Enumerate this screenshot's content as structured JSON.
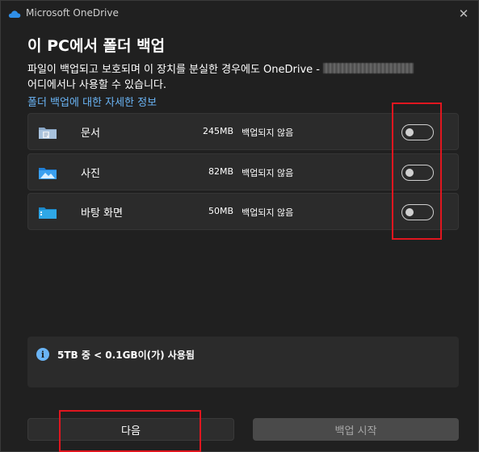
{
  "window": {
    "title": "Microsoft OneDrive",
    "close_glyph": "✕"
  },
  "heading": "이 PC에서 폴더 백업",
  "description": {
    "line1": "파일이 백업되고 보호되며 이 장치를 분실한 경우에도 OneDrive - ",
    "line2": "어디에서나 사용할 수 있습니다."
  },
  "learn_more_link": "폴더 백업에 대한 자세한 정보",
  "folders": [
    {
      "name": "문서",
      "size": "245MB",
      "status": "백업되지 않음",
      "icon": "documents-folder-icon",
      "enabled": false
    },
    {
      "name": "사진",
      "size": "82MB",
      "status": "백업되지 않음",
      "icon": "pictures-folder-icon",
      "enabled": false
    },
    {
      "name": "바탕 화면",
      "size": "50MB",
      "status": "백업되지 않음",
      "icon": "desktop-folder-icon",
      "enabled": false
    }
  ],
  "storage": {
    "icon": "info-icon",
    "icon_glyph": "i",
    "text": "5TB 중 < 0.1GB이(가) 사용됨"
  },
  "buttons": {
    "next_label": "다음",
    "start_backup_label": "백업 시작"
  },
  "colors": {
    "background": "#202020",
    "row_background": "#2b2b2b",
    "accent_link": "#6ab4f5",
    "highlight": "#e0161f"
  }
}
